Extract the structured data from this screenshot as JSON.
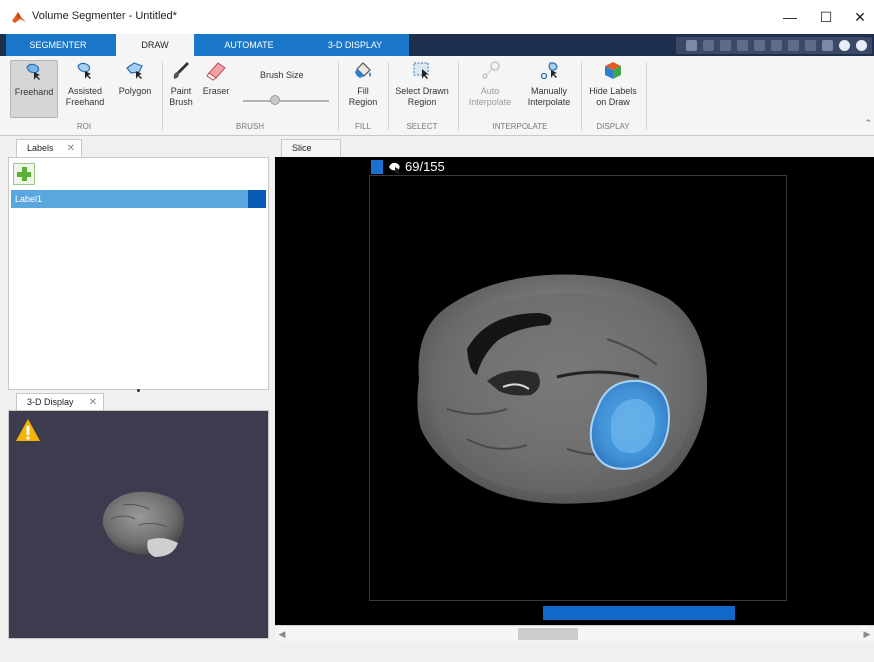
{
  "window": {
    "title": "Volume Segmenter - Untitled*",
    "minimize": "—",
    "maximize": "☐",
    "close": "✕"
  },
  "tabs": [
    {
      "label": "SEGMENTER"
    },
    {
      "label": "DRAW"
    },
    {
      "label": "AUTOMATE"
    },
    {
      "label": "3-D DISPLAY"
    }
  ],
  "active_tab": "DRAW",
  "ribbon": {
    "roi": {
      "group": "ROI",
      "freehand": [
        "Freehand"
      ],
      "assisted_freehand": [
        "Assisted",
        "Freehand"
      ],
      "polygon": [
        "Polygon"
      ]
    },
    "brush": {
      "group": "BRUSH",
      "paint_brush": [
        "Paint",
        "Brush"
      ],
      "eraser": [
        "Eraser"
      ],
      "brush_size": "Brush Size"
    },
    "fill": {
      "group": "FILL",
      "fill_region": [
        "Fill",
        "Region"
      ]
    },
    "select": {
      "group": "SELECT",
      "select_drawn_region": [
        "Select Drawn",
        "Region"
      ]
    },
    "interpolate": {
      "group": "INTERPOLATE",
      "auto_interpolate": [
        "Auto",
        "Interpolate"
      ],
      "manually_interpolate": [
        "Manually",
        "Interpolate"
      ]
    },
    "display": {
      "group": "DISPLAY",
      "hide_labels": [
        "Hide Labels",
        "on Draw"
      ]
    },
    "brush_size_level": 0.4
  },
  "labels_panel": {
    "tab": "Labels",
    "items": [
      {
        "name": "Label1",
        "color": "#0a5ab8"
      }
    ]
  },
  "display3d_panel": {
    "tab": "3-D Display"
  },
  "slice_panel": {
    "tab": "Slice",
    "slice_counter": "69/155",
    "label_color": "#1a6fd2"
  },
  "colors": {
    "accent": "#1976c8",
    "tabstrip": "#1e2f4e",
    "selection": "#5aa6de",
    "label_overlay": "#3c95e0"
  }
}
